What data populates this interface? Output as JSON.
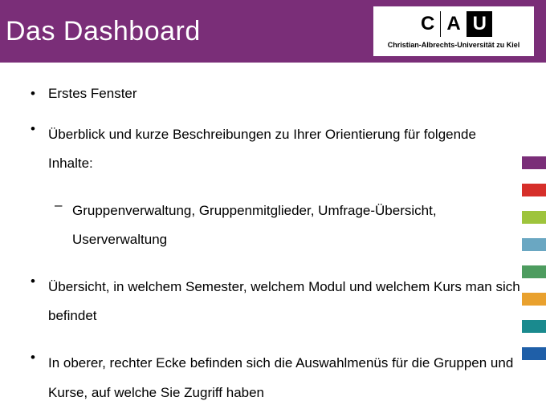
{
  "header": {
    "title": "Das Dashboard"
  },
  "logo": {
    "c": "C",
    "a": "A",
    "u": "U",
    "subtitle": "Christian-Albrechts-Universität zu Kiel"
  },
  "bullets": {
    "b1": "Erstes Fenster",
    "b2": "Überblick und kurze Beschreibungen zu Ihrer Orientierung für folgende Inhalte:",
    "b2_sub1": "Gruppenverwaltung, Gruppenmitglieder, Umfrage-Übersicht, Userverwaltung",
    "b3": "Übersicht, in welchem Semester, welchem Modul und welchem Kurs man sich befindet",
    "b4": "In oberer, rechter Ecke befinden sich die Auswahlmenüs für die Gruppen und Kurse, auf welche Sie Zugriff haben"
  },
  "stripe_colors": {
    "s1": "#7a2e78",
    "s2": "#d62f2a",
    "s3": "#9ec43c",
    "s4": "#6aa7c2",
    "s5": "#4d9c5f",
    "s6": "#e9a12e",
    "s7": "#1a8a8e",
    "s8": "#1f5fa8"
  }
}
